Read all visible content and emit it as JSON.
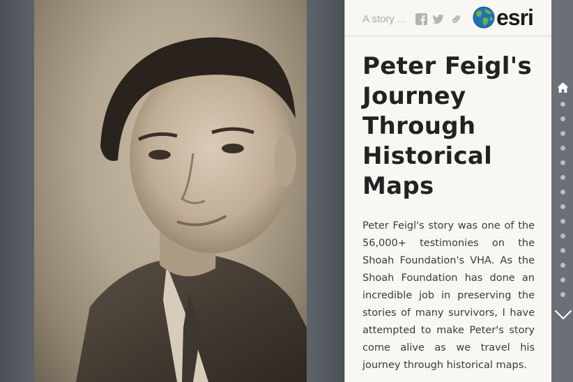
{
  "colors": {
    "panel_bg": "#f8f7f2",
    "rail_bg": "#6b7078",
    "title": "#222222",
    "body_text": "#3a3a3a",
    "muted": "#a9a9a9"
  },
  "header": {
    "subtitle": "A story ...",
    "share_icons": [
      "facebook-icon",
      "twitter-icon",
      "link-icon"
    ],
    "logo_text": "esri"
  },
  "story": {
    "title": "Peter Feigl's Journey Through Historical Maps",
    "intro": "Peter Feigl's story was one of the 56,000+ testimonies on the Shoah Foundation's VHA. As the Shoah Foundation has done an incredible job in preserving the stories of many survivors, I have attempted to make Peter's story come alive as we travel his journey through historical maps."
  },
  "navigation": {
    "home_icon": "home-icon",
    "section_count": 14,
    "next_icon": "chevron-down-icon"
  },
  "media": {
    "photo": "sepia portrait of a teenage boy in a tweed jacket"
  }
}
